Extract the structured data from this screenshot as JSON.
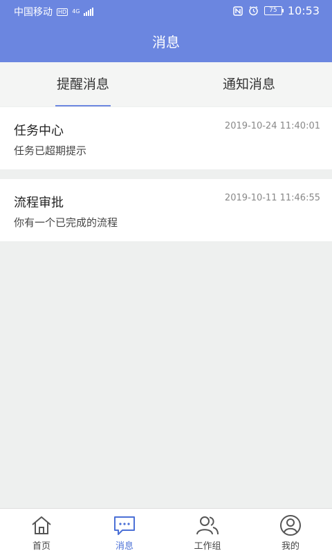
{
  "status_bar": {
    "carrier": "中国移动",
    "hd_badge": "HD",
    "network": "4G",
    "battery": "75",
    "time": "10:53"
  },
  "header": {
    "title": "消息"
  },
  "tabs": [
    {
      "label": "提醒消息",
      "active": true
    },
    {
      "label": "通知消息",
      "active": false
    }
  ],
  "messages": [
    {
      "title": "任务中心",
      "time": "2019-10-24 11:40:01",
      "desc": "任务已超期提示"
    },
    {
      "title": "流程审批",
      "time": "2019-10-11 11:46:55",
      "desc": "你有一个已完成的流程"
    }
  ],
  "bottom_nav": [
    {
      "label": "首页",
      "icon": "home-icon",
      "active": false
    },
    {
      "label": "消息",
      "icon": "message-icon",
      "active": true
    },
    {
      "label": "工作组",
      "icon": "group-icon",
      "active": false
    },
    {
      "label": "我的",
      "icon": "profile-icon",
      "active": false
    }
  ],
  "colors": {
    "accent": "#6b86e0",
    "active_nav": "#4a6fd6"
  }
}
